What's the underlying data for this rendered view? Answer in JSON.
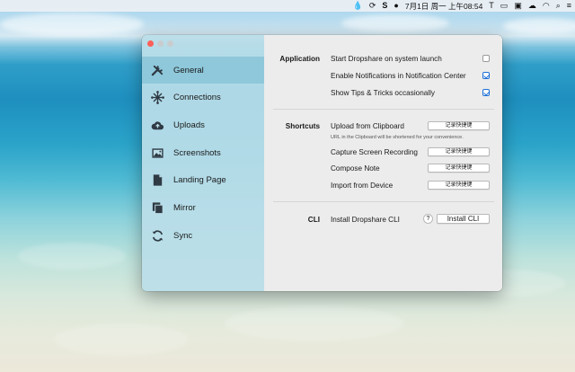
{
  "menubar": {
    "clock": "7月1日 周一 上午08:54",
    "icons": [
      "drop-icon",
      "sync-icon",
      "s-icon",
      "avatar-icon",
      "text-icon",
      "screen-record-icon",
      "display-icon",
      "cloud-icon",
      "wifi-icon",
      "search-icon",
      "control-center-icon"
    ]
  },
  "sidebar": {
    "items": [
      {
        "label": "General",
        "icon": "wrench-screwdriver-icon",
        "active": true
      },
      {
        "label": "Connections",
        "icon": "connections-icon"
      },
      {
        "label": "Uploads",
        "icon": "cloud-upload-icon"
      },
      {
        "label": "Screenshots",
        "icon": "image-icon"
      },
      {
        "label": "Landing Page",
        "icon": "document-icon"
      },
      {
        "label": "Mirror",
        "icon": "mirror-icon"
      },
      {
        "label": "Sync",
        "icon": "sync-icon"
      }
    ]
  },
  "application": {
    "label": "Application",
    "launch": {
      "label": "Start Dropshare on system launch",
      "checked": false
    },
    "notifications": {
      "label": "Enable Notifications in Notification Center",
      "checked": true
    },
    "tips": {
      "label": "Show Tips & Tricks occasionally",
      "checked": true
    }
  },
  "shortcuts": {
    "label": "Shortcuts",
    "upload": {
      "label": "Upload from Clipboard",
      "button": "记录快捷键"
    },
    "hint": "URL in the Clipboard will be shortened for your convenience.",
    "capture": {
      "label": "Capture Screen Recording",
      "button": "记录快捷键"
    },
    "compose": {
      "label": "Compose Note",
      "button": "记录快捷键"
    },
    "import": {
      "label": "Import from Device",
      "button": "记录快捷键"
    }
  },
  "cli": {
    "label": "CLI",
    "row_label": "Install Dropshare CLI",
    "help": "?",
    "button": "Install CLI"
  },
  "colors": {
    "sidebar_active": "#8ec8da",
    "check_accent": "#1f6fd6",
    "close_button": "#fc5f57"
  }
}
